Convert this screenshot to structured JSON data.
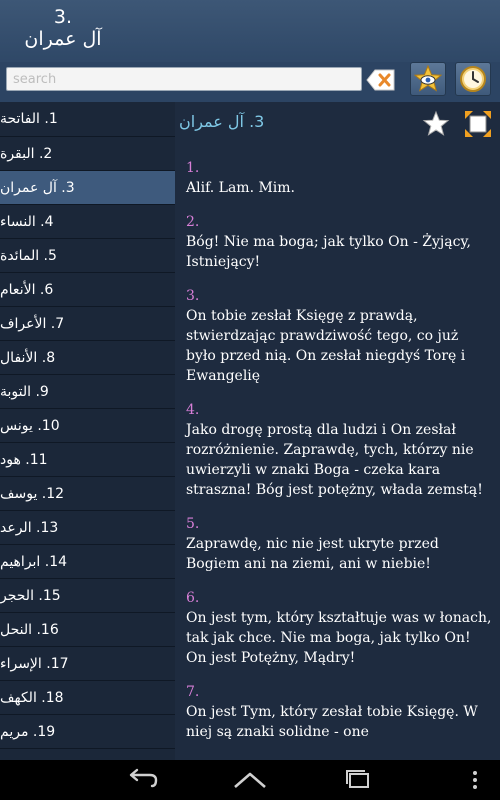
{
  "app": {
    "title_num": "3.",
    "title_name": "آل عمران"
  },
  "search": {
    "placeholder": "search",
    "value": ""
  },
  "sidebar": {
    "items": [
      {
        "label": "1. الفاتحة"
      },
      {
        "label": "2. البقرة"
      },
      {
        "label": "3. آل عمران",
        "selected": true
      },
      {
        "label": "4. النساء"
      },
      {
        "label": "5. المائدة"
      },
      {
        "label": "6. الأنعام"
      },
      {
        "label": "7. الأعراف"
      },
      {
        "label": "8. الأنفال"
      },
      {
        "label": "9. التوبة"
      },
      {
        "label": "10. يونس"
      },
      {
        "label": "11. هود"
      },
      {
        "label": "12. يوسف"
      },
      {
        "label": "13. الرعد"
      },
      {
        "label": "14. ابراهيم"
      },
      {
        "label": "15. الحجر"
      },
      {
        "label": "16. النحل"
      },
      {
        "label": "17. الإسراء"
      },
      {
        "label": "18. الكهف"
      },
      {
        "label": "19. مريم"
      }
    ]
  },
  "content": {
    "title": "3. آل عمران",
    "verses": [
      {
        "num": "1.",
        "text": "Alif. Lam. Mim."
      },
      {
        "num": "2.",
        "text": "Bóg! Nie ma boga; jak tylko On - Żyjący, Istniejący!"
      },
      {
        "num": "3.",
        "text": "On tobie zesłał Księgę z prawdą, stwierdzając prawdziwość tego, co już było przed nią. On zesłał niegdyś Torę i Ewangelię"
      },
      {
        "num": "4.",
        "text": "Jako drogę prostą dla ludzi i On zesłał rozróżnienie. Zaprawdę, tych, którzy nie uwierzyli w znaki Boga - czeka kara straszna! Bóg jest potężny, włada zemstą!"
      },
      {
        "num": "5.",
        "text": "Zaprawdę, nic nie jest ukryte przed Bogiem ani na ziemi, ani w niebie!"
      },
      {
        "num": "6.",
        "text": "On jest tym, który kształtuje was w łonach, tak jak chce. Nie ma boga, jak tylko On! On jest Potężny, Mądry!"
      },
      {
        "num": "7.",
        "text": "On jest Tym, który zesłał tobie Księgę. W niej są znaki solidne - one"
      }
    ]
  },
  "colors": {
    "header": "#3d5776",
    "sidebar_bg": "#1b2739",
    "selected": "#3e5a7d",
    "content_bg": "#1e2b3f",
    "title": "#7fc8e6",
    "verse_num": "#d77fd7"
  },
  "icons": [
    "delete-backspace-icon",
    "favorites-eye-icon",
    "clock-history-icon",
    "star-icon",
    "fullscreen-icon",
    "back-icon",
    "home-icon",
    "recent-apps-icon",
    "overflow-menu-icon"
  ]
}
